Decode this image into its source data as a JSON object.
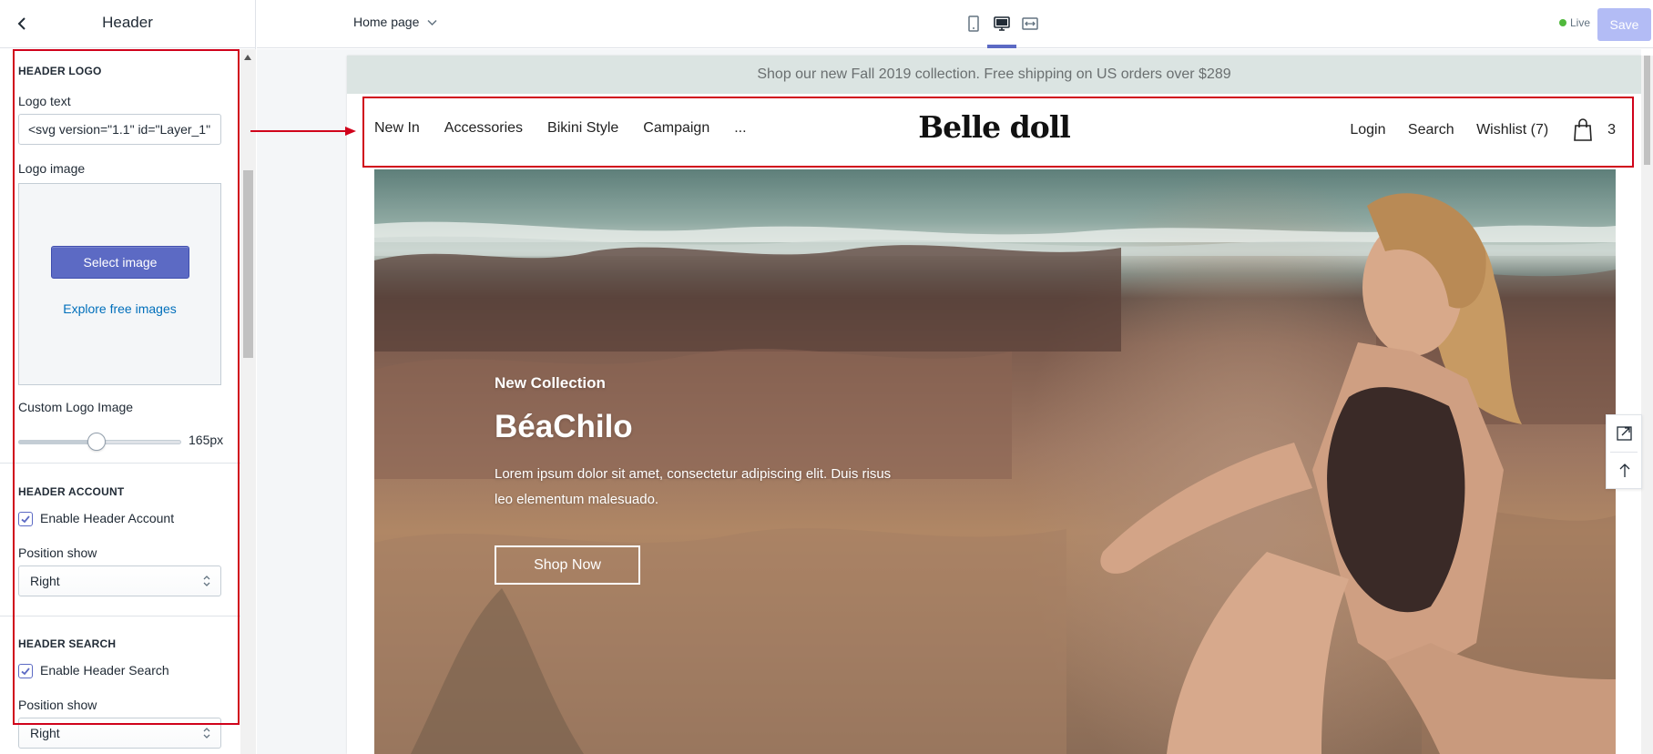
{
  "sidebar": {
    "title": "Header",
    "sections": {
      "logo": {
        "title": "HEADER LOGO",
        "logo_text_label": "Logo text",
        "logo_text_value": "<svg version=\"1.1\" id=\"Layer_1\"",
        "logo_image_label": "Logo image",
        "select_image_label": "Select image",
        "explore_link": "Explore free images",
        "custom_logo_label": "Custom Logo Image",
        "custom_logo_value": "165px",
        "slider_fraction": 0.48
      },
      "account": {
        "title": "HEADER ACCOUNT",
        "enable_label": "Enable Header Account",
        "enabled": true,
        "position_label": "Position show",
        "position_value": "Right"
      },
      "search": {
        "title": "HEADER SEARCH",
        "enable_label": "Enable Header Search",
        "enabled": true,
        "position_label": "Position show",
        "position_value": "Right"
      }
    }
  },
  "topbar": {
    "page_selector": "Home page",
    "views": [
      "mobile-icon",
      "desktop-icon",
      "fullwidth-icon"
    ],
    "active_view": "desktop",
    "status": "Live",
    "save_label": "Save"
  },
  "store": {
    "announcement": "Shop our new Fall 2019 collection. Free shipping on US orders over $289",
    "nav_left": [
      "New In",
      "Accessories",
      "Bikini Style",
      "Campaign",
      "..."
    ],
    "logo": "Belle doll",
    "nav_right": {
      "login": "Login",
      "search": "Search",
      "wishlist": "Wishlist (7)",
      "cart_count": "3"
    },
    "hero": {
      "kicker": "New Collection",
      "title": "BéaChilo",
      "description": "Lorem ipsum dolor sit amet, consectetur adipiscing elit. Duis risus leo elementum malesuado.",
      "button": "Shop Now"
    }
  },
  "colors": {
    "accent": "#5c6ac4",
    "announcement_bg": "#dbe4e2",
    "annotation_red": "#d0021b",
    "live_green": "#50b83c"
  }
}
